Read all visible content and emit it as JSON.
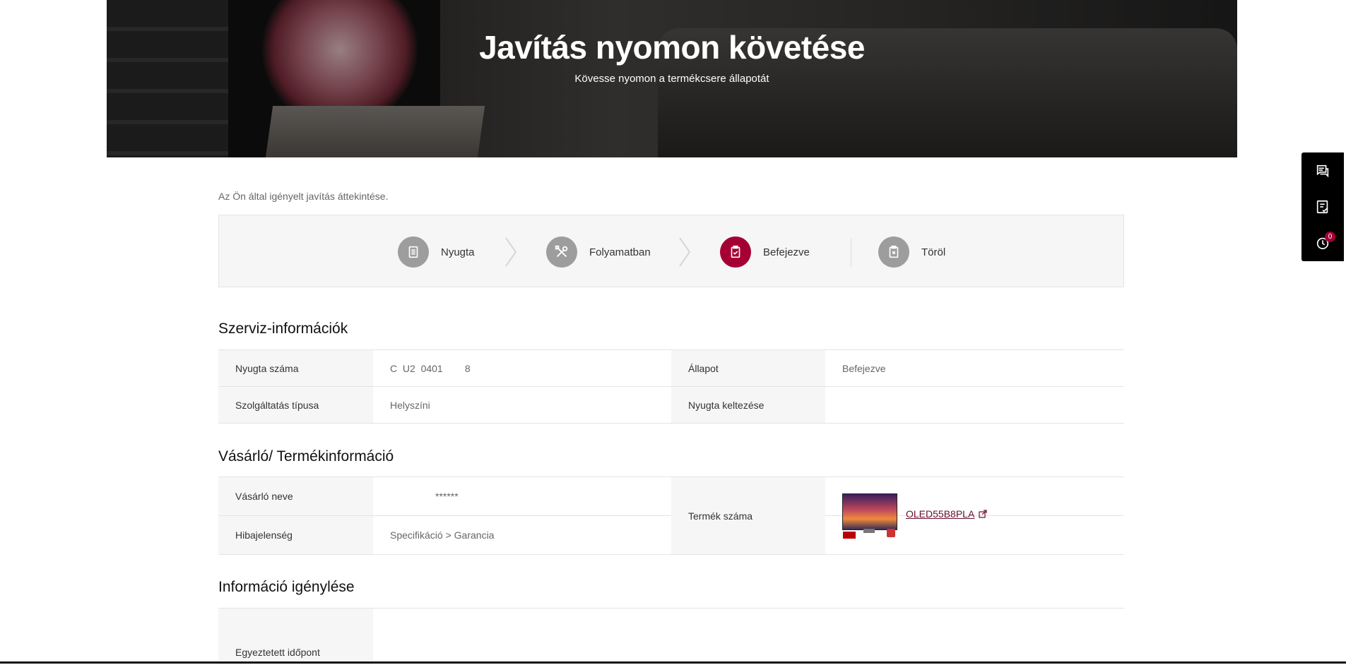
{
  "hero": {
    "title": "Javítás nyomon követése",
    "subtitle": "Kövesse nyomon a termékcsere állapotát"
  },
  "floating_menu": {
    "items": [
      "chat-icon",
      "checklist-icon",
      "history-icon"
    ],
    "history_badge": "0"
  },
  "intro_text": "Az Ön által igényelt javítás áttekintése.",
  "steps": [
    {
      "label": "Nyugta",
      "icon": "receipt-icon",
      "active": false
    },
    {
      "label": "Folyamatban",
      "icon": "tools-icon",
      "active": false
    },
    {
      "label": "Befejezve",
      "icon": "clipboard-check-icon",
      "active": true
    },
    {
      "label": "Töröl",
      "icon": "clipboard-x-icon",
      "active": false
    }
  ],
  "service_info": {
    "title": "Szerviz-információk",
    "receipt_number_label": "Nyugta száma",
    "receipt_number_value": "C  U2  0401        8",
    "status_label": "Állapot",
    "status_value": "Befejezve",
    "service_type_label": "Szolgáltatás típusa",
    "service_type_value": "Helyszíni",
    "receipt_date_label": "Nyugta keltezése",
    "receipt_date_value": ""
  },
  "customer_info": {
    "title": "Vásárló/ Termékinformáció",
    "customer_name_label": "Vásárló neve",
    "customer_name_value": "******",
    "issue_label": "Hibajelenség",
    "issue_value": "Specifikáció > Garancia",
    "product_number_label": "Termék száma",
    "product_number_value": "OLED55B8PLA"
  },
  "request_info": {
    "title": "Információ igénylése",
    "agreed_time_label": "Egyeztetett időpont",
    "agreed_time_value": ""
  },
  "colors": {
    "accent": "#a50034",
    "link": "#6b0e2e",
    "header_cell_bg": "#f6f6f6"
  }
}
